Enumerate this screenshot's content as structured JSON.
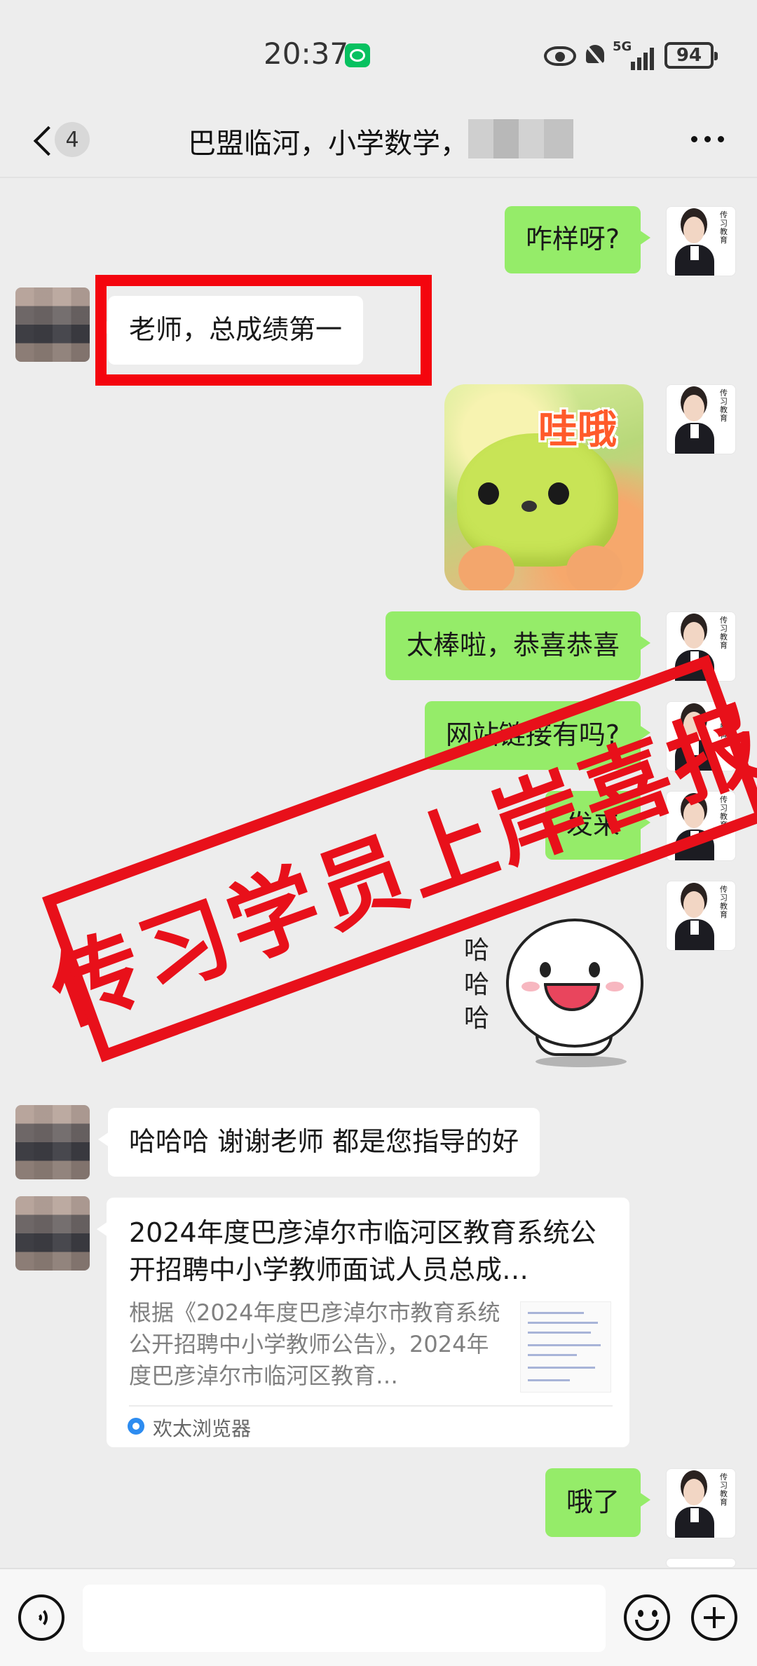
{
  "status_bar": {
    "time": "20:37",
    "network": "5G",
    "battery": "94"
  },
  "nav": {
    "unread_count": "4",
    "chat_title": "巴盟临河，小学数学，"
  },
  "avatar": {
    "teacher_tag": "传习教育"
  },
  "messages": {
    "m1": "咋样呀?",
    "m2": "老师，总成绩第一",
    "m3_sticker_text": "哇哦",
    "m4": "太棒啦，恭喜恭喜",
    "m5": "网站链接有吗?",
    "m6": "发来",
    "m7_sticker_text": "哈哈哈",
    "m8": "哈哈哈  谢谢老师   都是您指导的好",
    "m10": "哦了"
  },
  "link_card": {
    "title": "2024年度巴彦淖尔市临河区教育系统公开招聘中小学教师面试人员总成…",
    "description": "根据《2024年度巴彦淖尔市教育系统公开招聘中小学教师公告》，2024年度巴彦淖尔市临河区教育…",
    "source": "欢太浏览器"
  },
  "watermark": "传习学员上岸喜报",
  "colors": {
    "my_bubble": "#95ec69",
    "other_bubble": "#ffffff",
    "background": "#ededed",
    "stamp_red": "#e8101a"
  },
  "icons": [
    "back-icon",
    "more-icon",
    "voice-icon",
    "emoji-icon",
    "plus-icon",
    "eye-icon",
    "bell-off-icon",
    "wechat-icon"
  ]
}
